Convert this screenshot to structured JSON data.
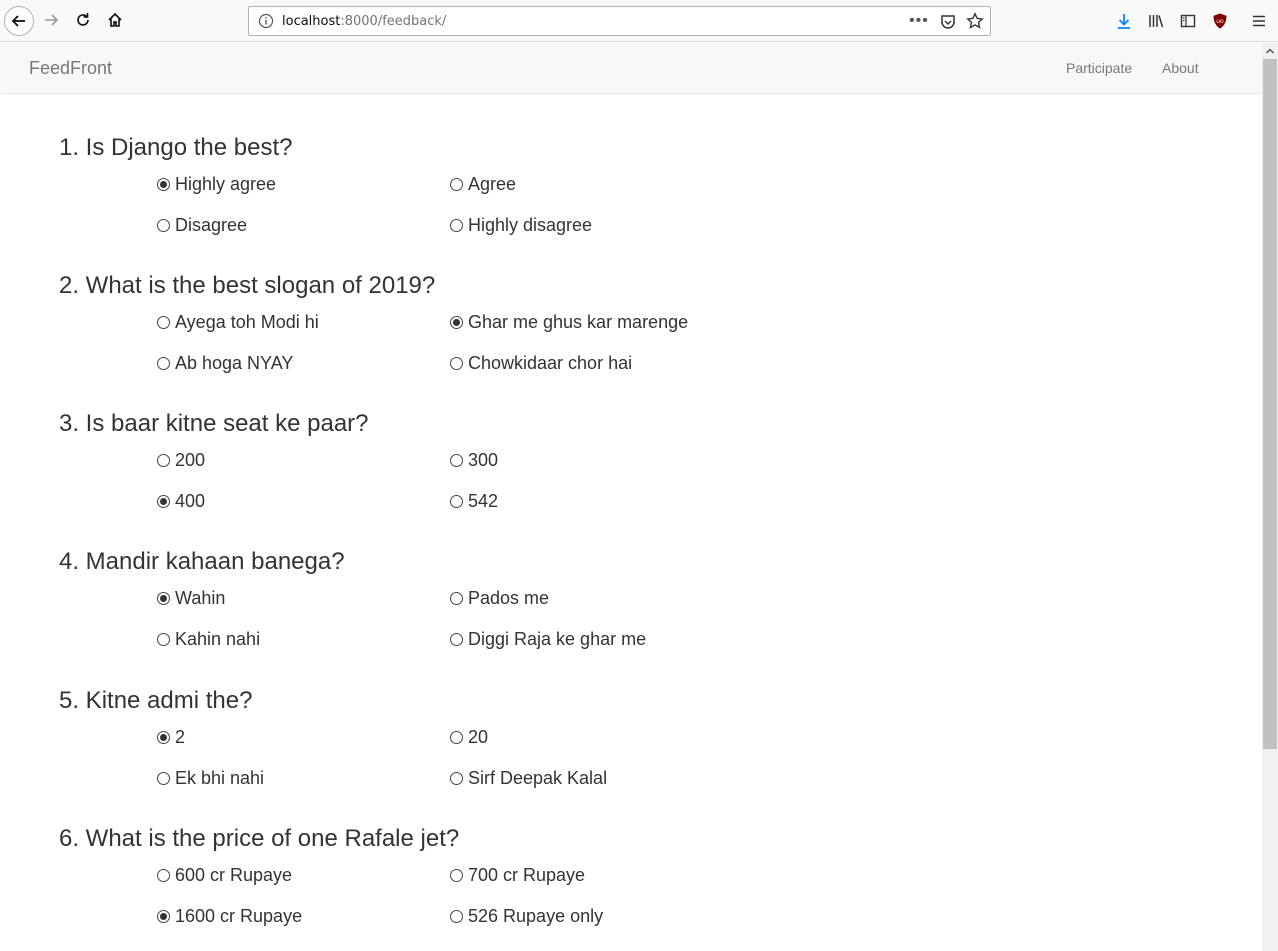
{
  "browser": {
    "url_host": "localhost",
    "url_path": ":8000/feedback/",
    "more_label": "•••"
  },
  "navbar": {
    "brand": "FeedFront",
    "links": [
      "Participate",
      "About"
    ]
  },
  "questions": [
    {
      "title": "1. Is Django the best?",
      "options": [
        {
          "label": "Highly agree",
          "checked": true
        },
        {
          "label": "Agree",
          "checked": false
        },
        {
          "label": "Disagree",
          "checked": false
        },
        {
          "label": "Highly disagree",
          "checked": false
        }
      ]
    },
    {
      "title": "2. What is the best slogan of 2019?",
      "options": [
        {
          "label": "Ayega toh Modi hi",
          "checked": false
        },
        {
          "label": "Ghar me ghus kar marenge",
          "checked": true
        },
        {
          "label": "Ab hoga NYAY",
          "checked": false
        },
        {
          "label": "Chowkidaar chor hai",
          "checked": false
        }
      ]
    },
    {
      "title": "3. Is baar kitne seat ke paar?",
      "options": [
        {
          "label": "200",
          "checked": false
        },
        {
          "label": "300",
          "checked": false
        },
        {
          "label": "400",
          "checked": true
        },
        {
          "label": "542",
          "checked": false
        }
      ]
    },
    {
      "title": "4. Mandir kahaan banega?",
      "options": [
        {
          "label": "Wahin",
          "checked": true
        },
        {
          "label": "Pados me",
          "checked": false
        },
        {
          "label": "Kahin nahi",
          "checked": false
        },
        {
          "label": "Diggi Raja ke ghar me",
          "checked": false
        }
      ]
    },
    {
      "title": "5. Kitne admi the?",
      "options": [
        {
          "label": "2",
          "checked": true
        },
        {
          "label": "20",
          "checked": false
        },
        {
          "label": "Ek bhi nahi",
          "checked": false
        },
        {
          "label": "Sirf Deepak Kalal",
          "checked": false
        }
      ]
    },
    {
      "title": "6. What is the price of one Rafale jet?",
      "options": [
        {
          "label": "600 cr Rupaye",
          "checked": false
        },
        {
          "label": "700 cr Rupaye",
          "checked": false
        },
        {
          "label": "1600 cr Rupaye",
          "checked": true
        },
        {
          "label": "526 Rupaye only",
          "checked": false
        }
      ]
    }
  ]
}
